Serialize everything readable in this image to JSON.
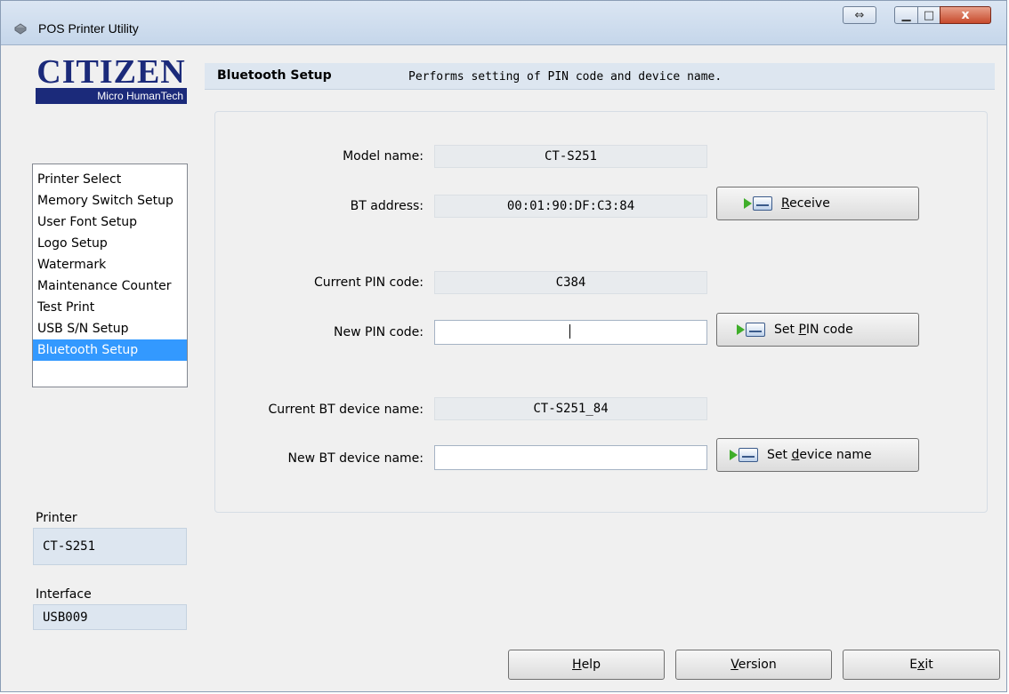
{
  "window": {
    "title": "POS Printer Utility"
  },
  "titlebar": {
    "resize_icon": "⇔",
    "min_icon": "▁",
    "max_icon": "□",
    "close_icon": "x"
  },
  "logo": {
    "brand": "CITIZEN",
    "tagline": "Micro HumanTech"
  },
  "header": {
    "title": "Bluetooth Setup",
    "description": "Performs setting of PIN code and device name."
  },
  "nav": {
    "items": [
      {
        "label": "Printer Select"
      },
      {
        "label": "Memory Switch Setup"
      },
      {
        "label": "User Font Setup"
      },
      {
        "label": "Logo Setup"
      },
      {
        "label": "Watermark"
      },
      {
        "label": "Maintenance Counter"
      },
      {
        "label": "Test Print"
      },
      {
        "label": "USB S/N Setup"
      },
      {
        "label": "Bluetooth Setup",
        "selected": true
      }
    ]
  },
  "sidebar": {
    "printer_label": "Printer",
    "printer_value": "CT-S251",
    "interface_label": "Interface",
    "interface_value": "USB009"
  },
  "form": {
    "model_name_label": "Model name:",
    "model_name_value": "CT-S251",
    "bt_address_label": "BT address:",
    "bt_address_value": "00:01:90:DF:C3:84",
    "current_pin_label": "Current PIN code:",
    "current_pin_value": "C384",
    "new_pin_label": "New PIN code:",
    "new_pin_value": "",
    "current_device_label": "Current BT device name:",
    "current_device_value": "CT-S251_84",
    "new_device_label": "New BT device name:",
    "new_device_value": ""
  },
  "buttons": {
    "receive_prefix": "",
    "receive_mnemonic": "R",
    "receive_rest": "eceive",
    "set_pin_prefix": "Set ",
    "set_pin_mnemonic": "P",
    "set_pin_rest": "IN code",
    "set_device_prefix": "Set ",
    "set_device_mnemonic": "d",
    "set_device_rest": "evice name",
    "help_mnemonic": "H",
    "help_rest": "elp",
    "version_mnemonic": "V",
    "version_rest": "ersion",
    "exit_prefix": "E",
    "exit_mnemonic": "x",
    "exit_rest": "it"
  },
  "colors": {
    "selection": "#3399ff",
    "header_bg": "#dde6f0",
    "arrow_green": "#3fae2a",
    "brand_blue": "#1b2a7a"
  }
}
